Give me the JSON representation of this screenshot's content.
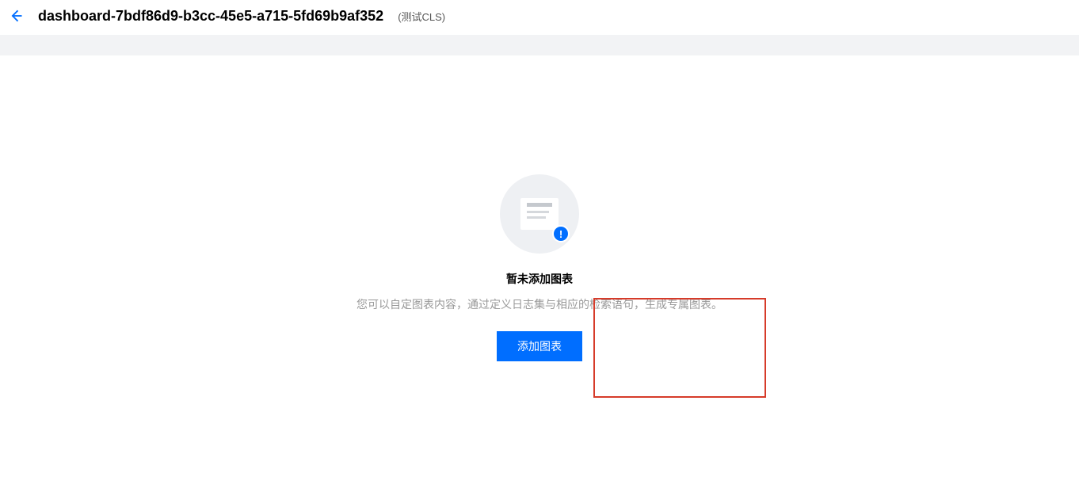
{
  "header": {
    "title": "dashboard-7bdf86d9-b3cc-45e5-a715-5fd69b9af352",
    "subtitle": "(测试CLS)"
  },
  "empty_state": {
    "title": "暂未添加图表",
    "description": "您可以自定图表内容，通过定义日志集与相应的检索语句，生成专属图表。",
    "button_label": "添加图表",
    "badge_glyph": "!"
  }
}
